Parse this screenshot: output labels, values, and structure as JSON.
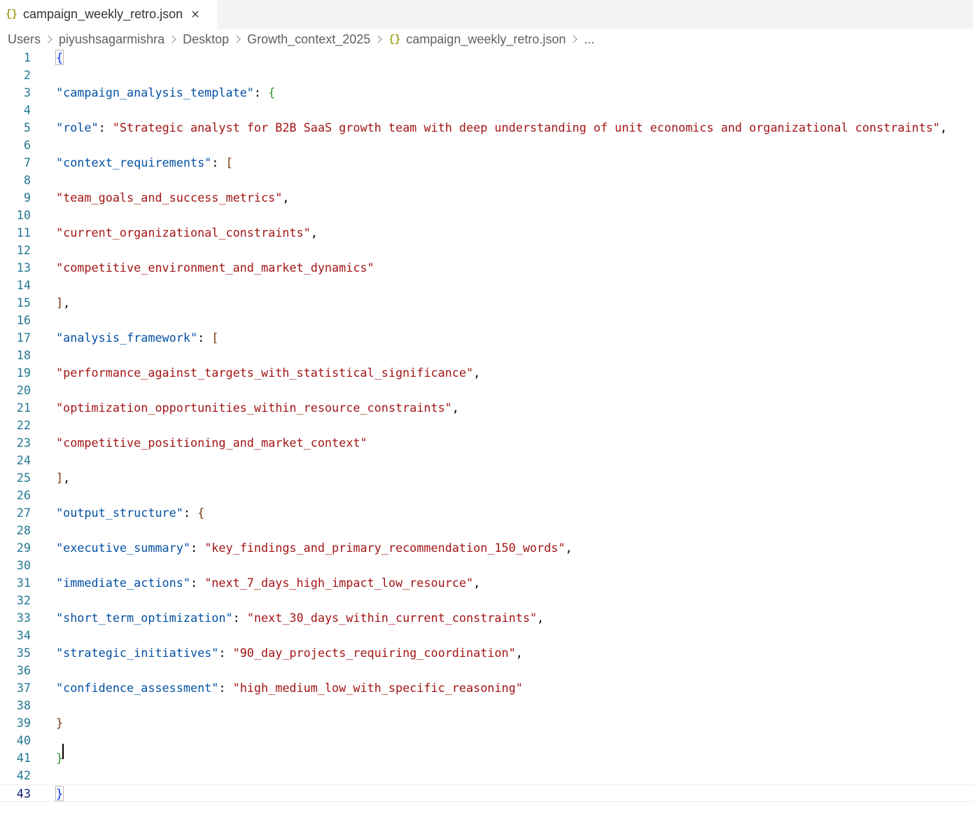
{
  "tab": {
    "icon": "json-braces-icon",
    "label": "campaign_weekly_retro.json",
    "close_glyph": "×"
  },
  "breadcrumb": {
    "items": [
      "Users",
      "piyushsagarmishra",
      "Desktop",
      "Growth_context_2025"
    ],
    "file_icon": "{}",
    "file": "campaign_weekly_retro.json",
    "more": "..."
  },
  "colors": {
    "key": "#0451a5",
    "string": "#a31515",
    "line_number": "#237893",
    "bracket_level1": "#0431fa",
    "bracket_level2": "#319331",
    "bracket_level3": "#7b3814"
  },
  "editor": {
    "lines": [
      {
        "n": "1",
        "tokens": [
          {
            "t": "{",
            "c": "b1"
          }
        ]
      },
      {
        "n": "2",
        "tokens": []
      },
      {
        "n": "3",
        "tokens": [
          {
            "t": "\"campaign_analysis_template\"",
            "c": "k"
          },
          {
            "t": ": ",
            "c": "p"
          },
          {
            "t": "{",
            "c": "b2"
          }
        ]
      },
      {
        "n": "4",
        "tokens": []
      },
      {
        "n": "5",
        "tokens": [
          {
            "t": "\"role\"",
            "c": "k"
          },
          {
            "t": ": ",
            "c": "p"
          },
          {
            "t": "\"Strategic analyst for B2B SaaS growth team with deep understanding of unit economics and organizational constraints\"",
            "c": "s"
          },
          {
            "t": ",",
            "c": "p"
          }
        ]
      },
      {
        "n": "6",
        "tokens": []
      },
      {
        "n": "7",
        "tokens": [
          {
            "t": "\"context_requirements\"",
            "c": "k"
          },
          {
            "t": ": ",
            "c": "p"
          },
          {
            "t": "[",
            "c": "b3"
          }
        ]
      },
      {
        "n": "8",
        "tokens": []
      },
      {
        "n": "9",
        "tokens": [
          {
            "t": "\"team_goals_and_success_metrics\"",
            "c": "s"
          },
          {
            "t": ",",
            "c": "p"
          }
        ]
      },
      {
        "n": "10",
        "tokens": []
      },
      {
        "n": "11",
        "tokens": [
          {
            "t": "\"current_organizational_constraints\"",
            "c": "s"
          },
          {
            "t": ",",
            "c": "p"
          }
        ]
      },
      {
        "n": "12",
        "tokens": []
      },
      {
        "n": "13",
        "tokens": [
          {
            "t": "\"competitive_environment_and_market_dynamics\"",
            "c": "s"
          }
        ]
      },
      {
        "n": "14",
        "tokens": []
      },
      {
        "n": "15",
        "tokens": [
          {
            "t": "]",
            "c": "b3"
          },
          {
            "t": ",",
            "c": "p"
          }
        ]
      },
      {
        "n": "16",
        "tokens": []
      },
      {
        "n": "17",
        "tokens": [
          {
            "t": "\"analysis_framework\"",
            "c": "k"
          },
          {
            "t": ": ",
            "c": "p"
          },
          {
            "t": "[",
            "c": "b3"
          }
        ]
      },
      {
        "n": "18",
        "tokens": []
      },
      {
        "n": "19",
        "tokens": [
          {
            "t": "\"performance_against_targets_with_statistical_significance\"",
            "c": "s"
          },
          {
            "t": ",",
            "c": "p"
          }
        ]
      },
      {
        "n": "20",
        "tokens": []
      },
      {
        "n": "21",
        "tokens": [
          {
            "t": "\"optimization_opportunities_within_resource_constraints\"",
            "c": "s"
          },
          {
            "t": ",",
            "c": "p"
          }
        ]
      },
      {
        "n": "22",
        "tokens": []
      },
      {
        "n": "23",
        "tokens": [
          {
            "t": "\"competitive_positioning_and_market_context\"",
            "c": "s"
          }
        ]
      },
      {
        "n": "24",
        "tokens": []
      },
      {
        "n": "25",
        "tokens": [
          {
            "t": "]",
            "c": "b3"
          },
          {
            "t": ",",
            "c": "p"
          }
        ]
      },
      {
        "n": "26",
        "tokens": []
      },
      {
        "n": "27",
        "tokens": [
          {
            "t": "\"output_structure\"",
            "c": "k"
          },
          {
            "t": ": ",
            "c": "p"
          },
          {
            "t": "{",
            "c": "b3"
          }
        ]
      },
      {
        "n": "28",
        "tokens": []
      },
      {
        "n": "29",
        "tokens": [
          {
            "t": "\"executive_summary\"",
            "c": "k"
          },
          {
            "t": ": ",
            "c": "p"
          },
          {
            "t": "\"key_findings_and_primary_recommendation_150_words\"",
            "c": "s"
          },
          {
            "t": ",",
            "c": "p"
          }
        ]
      },
      {
        "n": "30",
        "tokens": []
      },
      {
        "n": "31",
        "tokens": [
          {
            "t": "\"immediate_actions\"",
            "c": "k"
          },
          {
            "t": ": ",
            "c": "p"
          },
          {
            "t": "\"next_7_days_high_impact_low_resource\"",
            "c": "s"
          },
          {
            "t": ",",
            "c": "p"
          }
        ]
      },
      {
        "n": "32",
        "tokens": []
      },
      {
        "n": "33",
        "tokens": [
          {
            "t": "\"short_term_optimization\"",
            "c": "k"
          },
          {
            "t": ": ",
            "c": "p"
          },
          {
            "t": "\"next_30_days_within_current_constraints\"",
            "c": "s"
          },
          {
            "t": ",",
            "c": "p"
          }
        ]
      },
      {
        "n": "34",
        "tokens": []
      },
      {
        "n": "35",
        "tokens": [
          {
            "t": "\"strategic_initiatives\"",
            "c": "k"
          },
          {
            "t": ": ",
            "c": "p"
          },
          {
            "t": "\"90_day_projects_requiring_coordination\"",
            "c": "s"
          },
          {
            "t": ",",
            "c": "p"
          }
        ]
      },
      {
        "n": "36",
        "tokens": []
      },
      {
        "n": "37",
        "tokens": [
          {
            "t": "\"confidence_assessment\"",
            "c": "k"
          },
          {
            "t": ": ",
            "c": "p"
          },
          {
            "t": "\"high_medium_low_with_specific_reasoning\"",
            "c": "s"
          }
        ]
      },
      {
        "n": "38",
        "tokens": []
      },
      {
        "n": "39",
        "tokens": [
          {
            "t": "}",
            "c": "b3"
          }
        ]
      },
      {
        "n": "40",
        "tokens": []
      },
      {
        "n": "41",
        "tokens": [
          {
            "t": "}",
            "c": "b2"
          }
        ]
      },
      {
        "n": "42",
        "tokens": []
      },
      {
        "n": "43",
        "tokens": [
          {
            "t": "}",
            "c": "b1"
          }
        ],
        "current": true
      }
    ]
  }
}
